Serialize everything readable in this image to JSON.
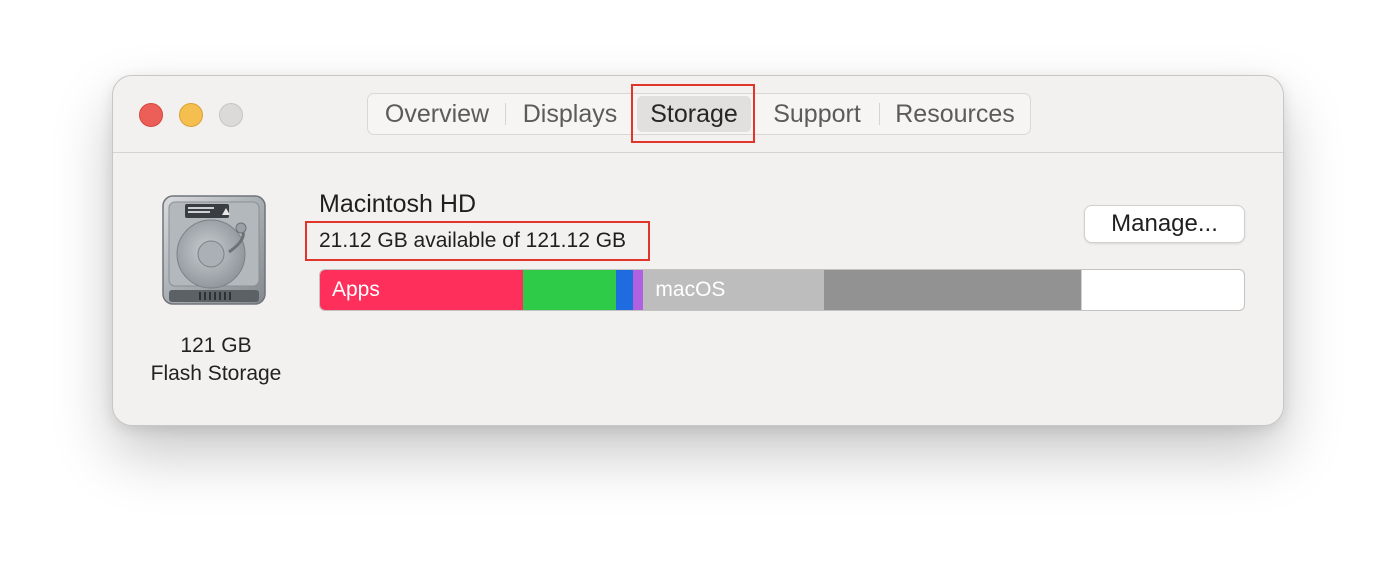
{
  "window": {
    "traffic_lights": [
      "close",
      "minimize",
      "zoom"
    ]
  },
  "tabs": [
    {
      "label": "Overview",
      "active": false
    },
    {
      "label": "Displays",
      "active": false
    },
    {
      "label": "Storage",
      "active": true
    },
    {
      "label": "Support",
      "active": false
    },
    {
      "label": "Resources",
      "active": false
    }
  ],
  "disk": {
    "icon": "hard-drive-icon",
    "size": "121 GB",
    "type": "Flash Storage"
  },
  "volume": {
    "name": "Macintosh HD",
    "available_text": "21.12 GB available of 121.12 GB",
    "manage_label": "Manage..."
  },
  "storage_bar": {
    "total_gb": 121.12,
    "available_gb": 21.12,
    "segments": [
      {
        "label": "Apps",
        "fraction": 0.22,
        "color": "#fe2f5a"
      },
      {
        "label": "",
        "fraction": 0.1,
        "color": "#2ecb48"
      },
      {
        "label": "",
        "fraction": 0.019,
        "color": "#1f6ce0"
      },
      {
        "label": "",
        "fraction": 0.011,
        "color": "#b061e0"
      },
      {
        "label": "macOS",
        "fraction": 0.195,
        "color": "#bdbdbd"
      },
      {
        "label": "",
        "fraction": 0.279,
        "color": "#929292"
      }
    ],
    "free_color": "#ffffff"
  },
  "colors": {
    "highlight": "#e0352b",
    "window_bg": "#f3f1ef"
  }
}
